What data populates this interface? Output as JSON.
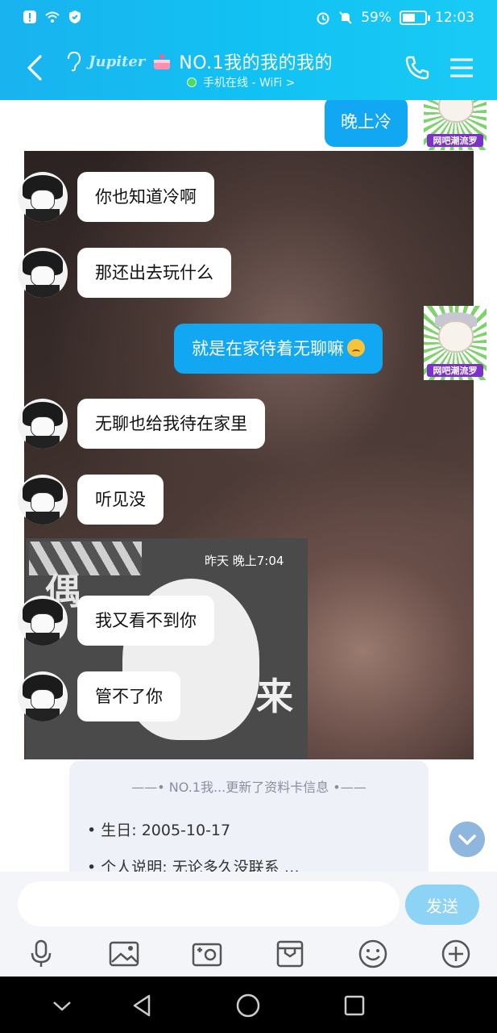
{
  "status_bar": {
    "battery_text": "59%",
    "battery_level": 0.59,
    "time": "12:03",
    "icons": [
      "alert-icon",
      "wifi-icon",
      "shield-icon",
      "alarm-icon",
      "mute-icon",
      "battery-icon"
    ]
  },
  "header": {
    "tag": "Jupiter",
    "name": "NO.1我的我的我的",
    "status": "手机在线 - WiFi >",
    "colors": {
      "gradient_start": "#19b3ef",
      "gradient_end": "#19cbf5"
    }
  },
  "messages": [
    {
      "side": "out",
      "text": "晚上冷"
    },
    {
      "side": "in",
      "text": "你也知道冷啊"
    },
    {
      "side": "in",
      "text": "那还出去玩什么"
    },
    {
      "side": "out",
      "text": "就是在家待着无聊嘛"
    },
    {
      "side": "in",
      "text": "无聊也给我待在家里"
    },
    {
      "side": "in",
      "text": "听见没"
    },
    {
      "side": "in",
      "text": "我又看不到你"
    },
    {
      "side": "in",
      "text": "管不了你"
    }
  ],
  "timestamp": "昨天 晚上7:04",
  "sticker_text": {
    "left": "偶",
    "right": "来"
  },
  "my_avatar_label": "网吧潮流罗",
  "profile_card": {
    "title": "——• NO.1我...更新了资料卡信息 •——",
    "birthday": "• 生日:   2005-10-17",
    "bio": "• 个人说明:   无论多久没联系   …"
  },
  "input": {
    "placeholder": "",
    "send_label": "发送"
  },
  "toolbar_icons": [
    "microphone-icon",
    "image-icon",
    "camera-icon",
    "file-icon",
    "emoji-icon",
    "plus-icon"
  ],
  "nav_icons": [
    "nav-down-icon",
    "nav-back-icon",
    "nav-home-icon",
    "nav-recents-icon"
  ]
}
